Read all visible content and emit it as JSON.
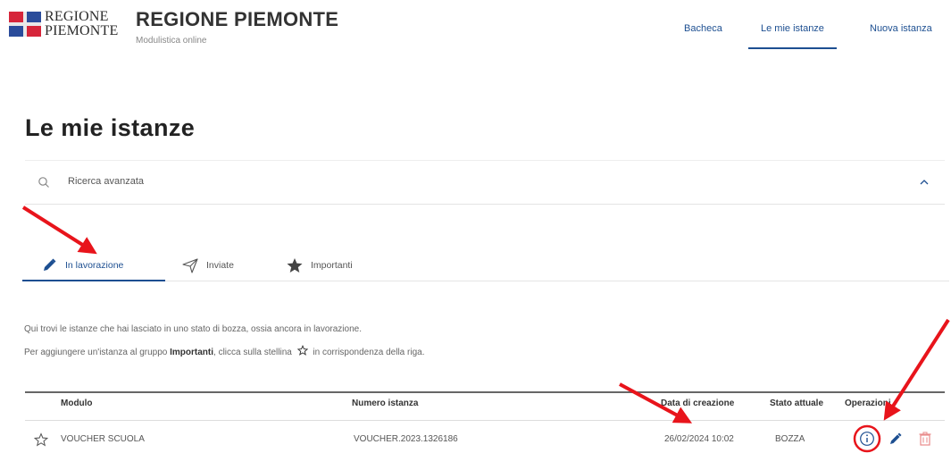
{
  "header": {
    "logo_line1": "REGIONE",
    "logo_line2": "PIEMONTE",
    "title": "REGIONE PIEMONTE",
    "subtitle": "Modulistica online",
    "nav": [
      {
        "label": "Bacheca"
      },
      {
        "label": "Le mie istanze",
        "active": true
      },
      {
        "label": "Nuova istanza"
      }
    ]
  },
  "page_title": "Le mie istanze",
  "search": {
    "label": "Ricerca avanzata"
  },
  "tabs": [
    {
      "label": "In lavorazione",
      "icon": "pencil-icon",
      "active": true
    },
    {
      "label": "Inviate",
      "icon": "paper-plane-icon"
    },
    {
      "label": "Importanti",
      "icon": "star-icon"
    }
  ],
  "description": {
    "line1": "Qui trovi le istanze che hai lasciato in uno stato di bozza, ossia ancora in lavorazione.",
    "line2_pre": "Per aggiungere un'istanza al gruppo ",
    "line2_bold": "Importanti",
    "line2_post": ", clicca sulla stellina",
    "line2_end": "in corrispondenza della riga."
  },
  "table": {
    "headers": [
      "Modulo",
      "Numero istanza",
      "Data di creazione",
      "Stato attuale",
      "Operazioni"
    ],
    "rows": [
      {
        "modulo": "VOUCHER SCUOLA",
        "numero": "VOUCHER.2023.1326186",
        "data": "26/02/2024 10:02",
        "stato": "BOZZA"
      }
    ]
  },
  "colors": {
    "accent": "#1d4f91",
    "annotation": "#e8141b",
    "delete": "#e88a8a",
    "logo_red": "#d6253a",
    "logo_blue": "#2a4c9b"
  }
}
